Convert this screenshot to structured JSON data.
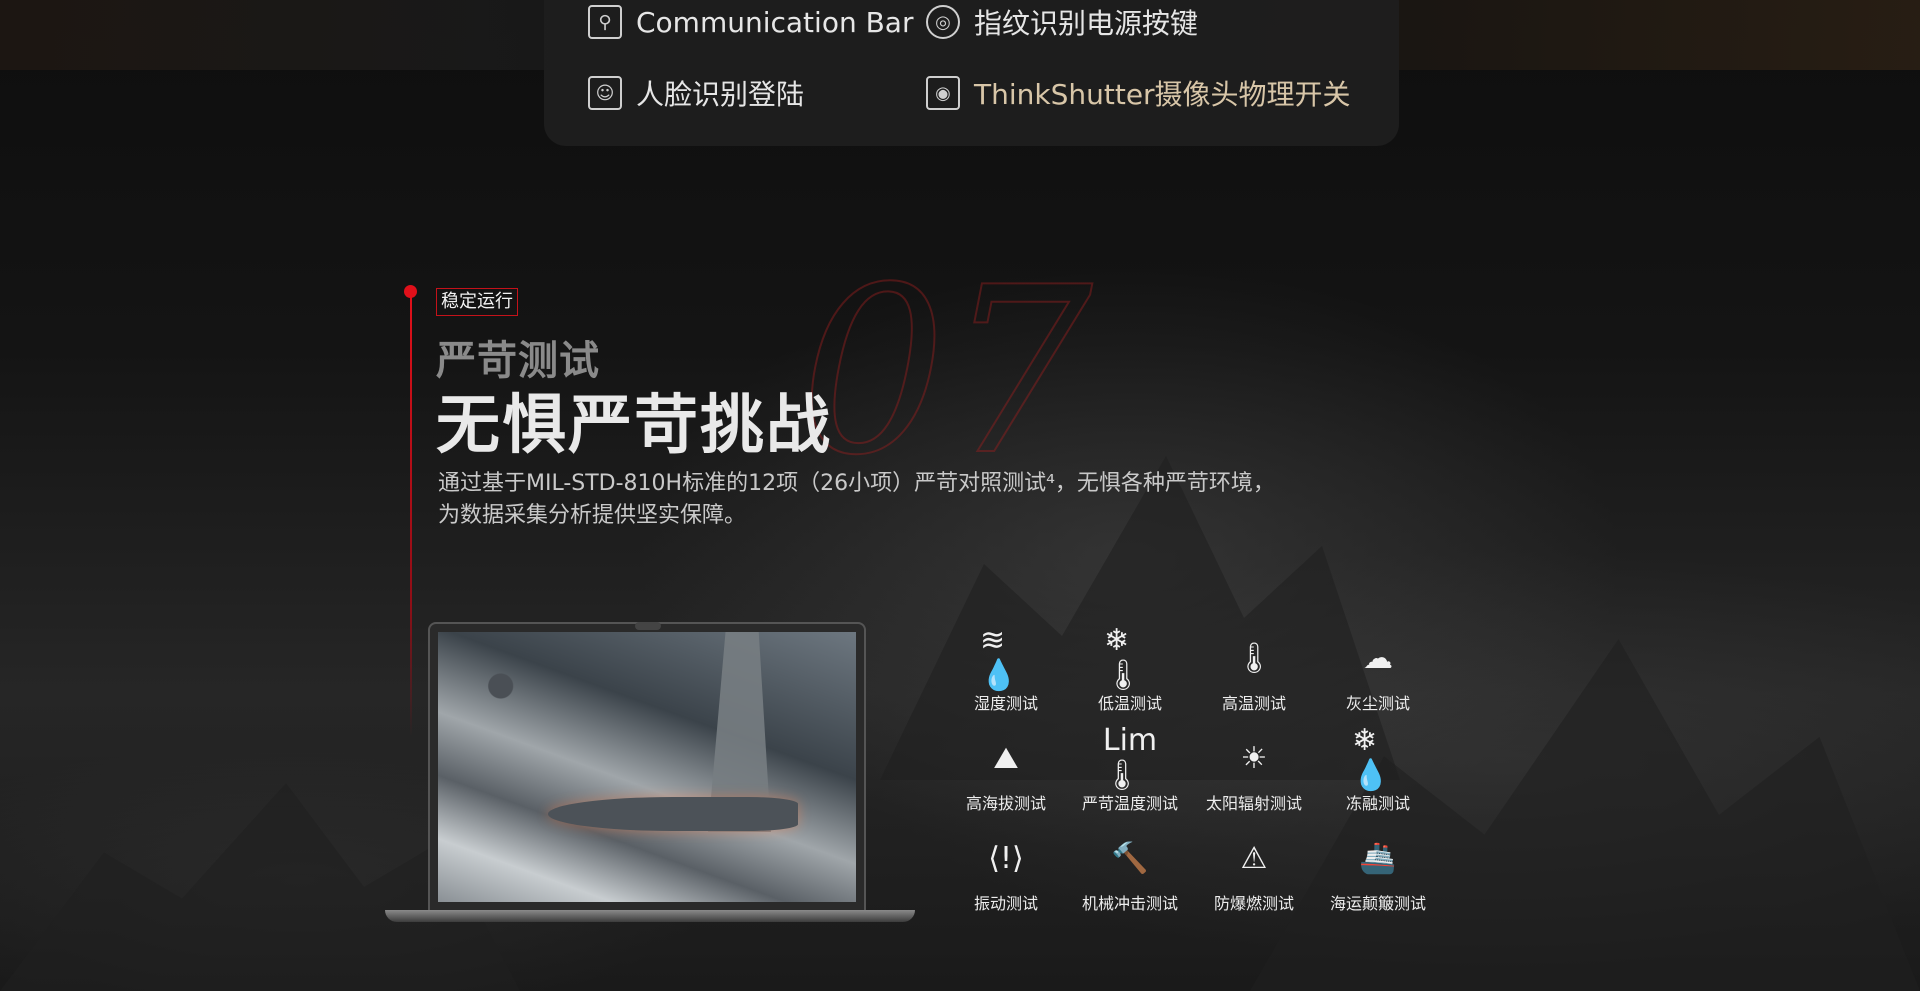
{
  "features": [
    {
      "label": "Communication Bar",
      "icon": "profile-card-icon"
    },
    {
      "label": "指纹识别电源按键",
      "icon": "fingerprint-icon"
    },
    {
      "label": "人脸识别登陆",
      "icon": "face-recognition-icon"
    },
    {
      "label": "ThinkShutter摄像头物理开关",
      "icon": "camera-shutter-icon"
    }
  ],
  "section": {
    "tag": "稳定运行",
    "number": "07",
    "subtitle": "严苛测试",
    "title": "无惧严苛挑战",
    "description_line1": "通过基于MIL-STD-810H标准的12项（26小项）严苛对照测试⁴，无惧各种严苛环境，",
    "description_line2": "为数据采集分析提供坚实保障。"
  },
  "tests": [
    {
      "label": "湿度测试",
      "icon": "humidity-icon",
      "glyph": "≋💧"
    },
    {
      "label": "低温测试",
      "icon": "low-temperature-icon",
      "glyph": "❄🌡"
    },
    {
      "label": "高温测试",
      "icon": "high-temperature-icon",
      "glyph": "🌡"
    },
    {
      "label": "灰尘测试",
      "icon": "dust-icon",
      "glyph": "☁"
    },
    {
      "label": "高海拔测试",
      "icon": "high-altitude-icon",
      "glyph": "⛰"
    },
    {
      "label": "严苛温度测试",
      "icon": "extreme-temperature-icon",
      "glyph": "Lim🌡"
    },
    {
      "label": "太阳辐射测试",
      "icon": "solar-radiation-icon",
      "glyph": "☀"
    },
    {
      "label": "冻融测试",
      "icon": "freeze-thaw-icon",
      "glyph": "❄💧"
    },
    {
      "label": "振动测试",
      "icon": "vibration-icon",
      "glyph": "⟨!⟩"
    },
    {
      "label": "机械冲击测试",
      "icon": "mechanical-shock-icon",
      "glyph": "🔨"
    },
    {
      "label": "防爆燃测试",
      "icon": "explosion-proof-icon",
      "glyph": "⚠"
    },
    {
      "label": "海运颠簸测试",
      "icon": "shipping-icon",
      "glyph": "🚢"
    }
  ],
  "colors": {
    "accent": "#e0101a",
    "gold_text": "#d8c6a8"
  }
}
